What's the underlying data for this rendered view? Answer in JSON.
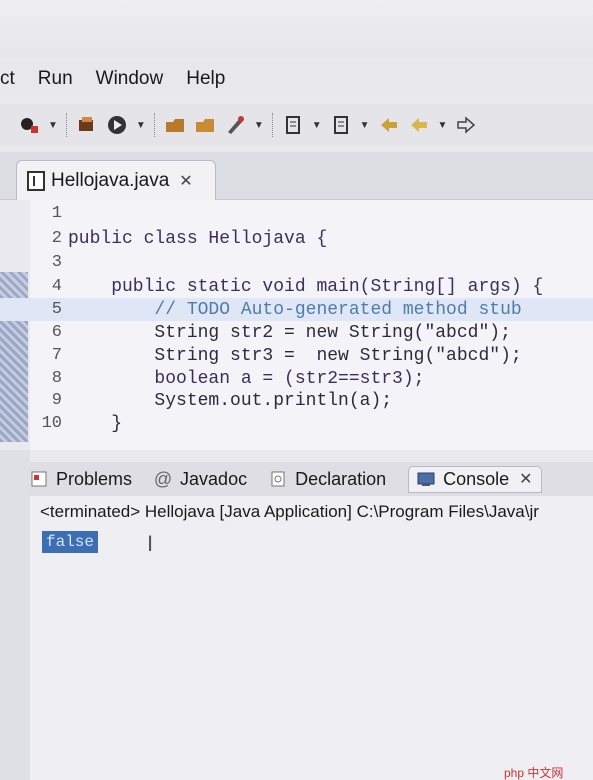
{
  "menu": {
    "items": [
      "ct",
      "Run",
      "Window",
      "Help"
    ]
  },
  "editor": {
    "tab_label": "Hellojava.java",
    "lines": [
      {
        "n": "1",
        "code": ""
      },
      {
        "n": "2",
        "code": "public class Hellojava {"
      },
      {
        "n": "3",
        "code": ""
      },
      {
        "n": "4",
        "code": "    public static void main(String[] args) {"
      },
      {
        "n": "5",
        "code": "        // TODO Auto-generated method stub"
      },
      {
        "n": "6",
        "code": "        String str2 = new String(\"abcd\");"
      },
      {
        "n": "7",
        "code": "        String str3 =  new String(\"abcd\");"
      },
      {
        "n": "8",
        "code": "        boolean a = (str2==str3);"
      },
      {
        "n": "9",
        "code": "        System.out.println(a);"
      },
      {
        "n": "10",
        "code": "    }"
      }
    ]
  },
  "console": {
    "tabs": [
      "Problems",
      "Javadoc",
      "Declaration",
      "Console"
    ],
    "status": "<terminated> Hellojava [Java Application] C:\\Program Files\\Java\\jr",
    "output": "false"
  },
  "watermark": "php 中文网",
  "colors": {
    "selection": "#3c6fb2",
    "current_line": "#dfe6f6",
    "keyword": "#3a2f5a",
    "comment": "#4e7da8"
  },
  "icons": [
    "debug-icon",
    "run-icon",
    "new-java-project-icon",
    "open-type-icon",
    "search-icon",
    "back-icon",
    "forward-icon"
  ]
}
